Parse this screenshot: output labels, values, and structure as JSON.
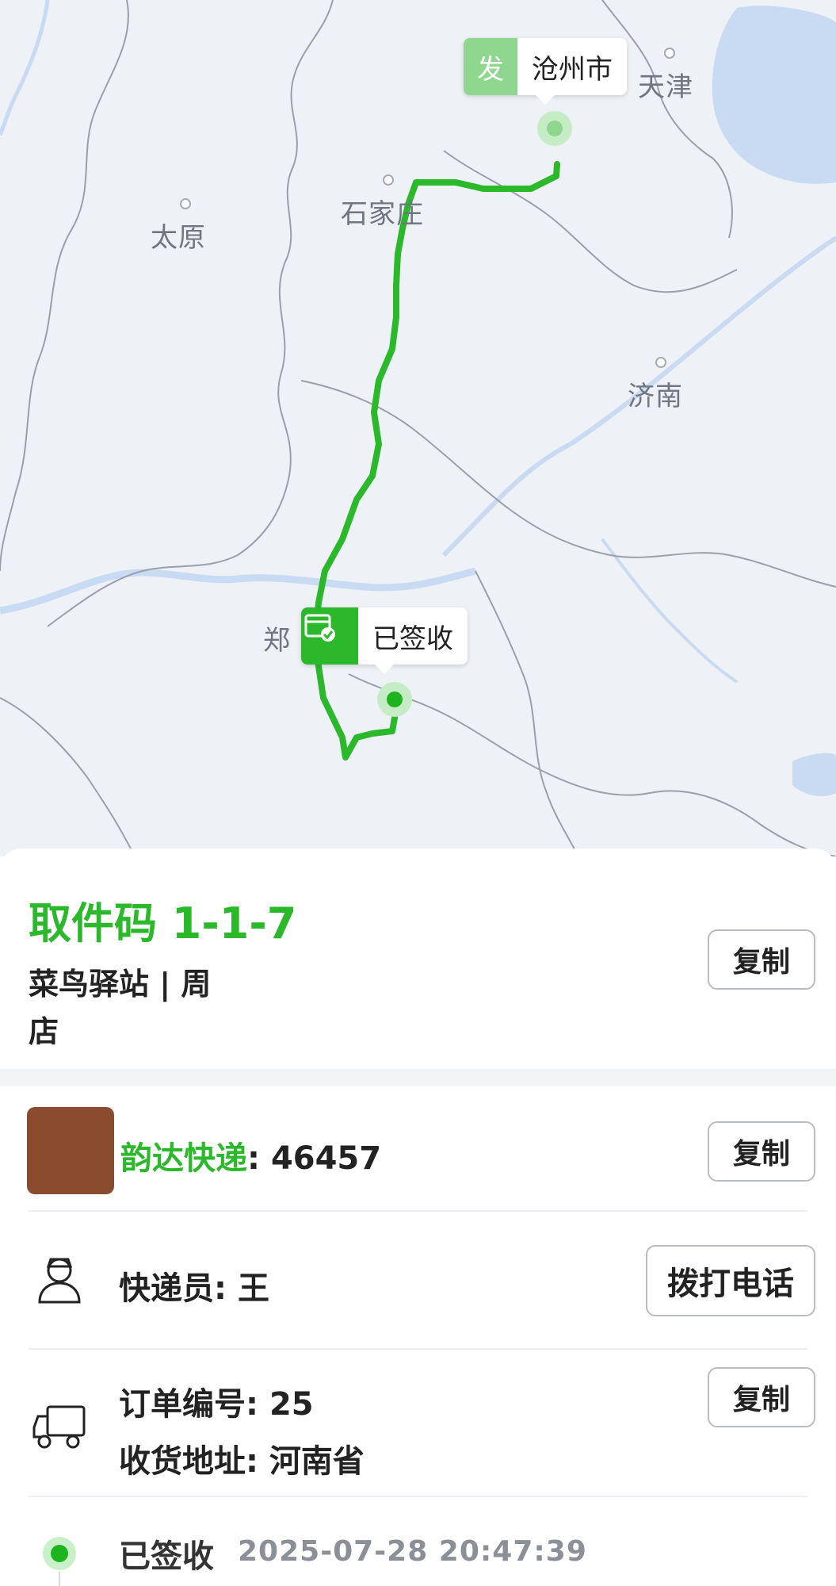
{
  "map": {
    "cities": [
      {
        "id": "taiyuan",
        "name": "太原"
      },
      {
        "id": "shijiazhuang",
        "name": "石家庄"
      },
      {
        "id": "tianjin",
        "name": "天津"
      },
      {
        "id": "jinan",
        "name": "济南"
      },
      {
        "id": "zhengzhou",
        "name": "郑"
      }
    ],
    "origin": {
      "tag": "发",
      "label": "沧州市"
    },
    "destination": {
      "label": "已签收"
    },
    "colors": {
      "route": "#2bb82b",
      "water": "#c9dbf2",
      "land": "#eef1f6",
      "border": "#9aa0aa"
    }
  },
  "pickup": {
    "code": "取件码 1-1-7",
    "station_line1": "菜鸟驿站 | 周",
    "station_line2": "店",
    "copy_label": "复制"
  },
  "tracking": {
    "carrier": "韵达快递",
    "separator": ":",
    "number": "46457",
    "copy_label": "复制"
  },
  "courier": {
    "label": "快递员:",
    "name": "王",
    "call_label": "拨打电话"
  },
  "order": {
    "order_label": "订单编号:",
    "order_value": "25",
    "address_label": "收货地址:",
    "address_value": "河南省",
    "copy_label": "复制"
  },
  "status": {
    "label": "已签收",
    "time": "2025-07-28 20:47:39"
  }
}
